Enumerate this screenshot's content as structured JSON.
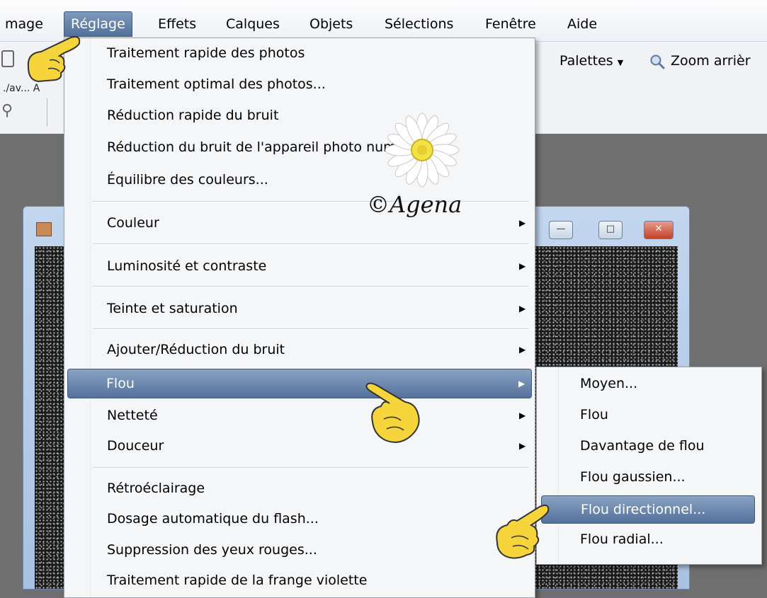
{
  "menubar": {
    "items": [
      "mage",
      "Réglage",
      "Effets",
      "Calques",
      "Objets",
      "Sélections",
      "Fenêtre",
      "Aide"
    ]
  },
  "toolbar": {
    "path_fragment": "./av... A",
    "palettes_label": "Palettes",
    "zoom_label": "Zoom arrièr"
  },
  "menu": {
    "group1": [
      "Traitement rapide des photos",
      "Traitement optimal des photos...",
      "Réduction rapide du bruit",
      "Réduction du bruit de l'appareil photo numérique...",
      "Équilibre des couleurs..."
    ],
    "couleur": "Couleur",
    "luminosite": "Luminosité et contraste",
    "teinte": "Teinte et saturation",
    "group5": [
      "Ajouter/Réduction du bruit",
      "Flou",
      "Netteté",
      "Douceur"
    ],
    "group6": [
      "Rétroéclairage",
      "Dosage automatique du flash...",
      "Suppression des yeux rouges...",
      "Traitement rapide de la frange violette"
    ]
  },
  "submenu": {
    "items": [
      "Moyen...",
      "Flou",
      "Davantage de flou",
      "Flou gaussien...",
      "Flou directionnel...",
      "Flou radial..."
    ]
  },
  "watermark": {
    "text": "©Agena"
  },
  "colors": {
    "highlight": "#6983aa",
    "menu_bg": "#f5f6f8",
    "close_button": "#d0533d"
  },
  "icons": [
    "pointing-hand-icon",
    "zoom-magnifier-icon",
    "submenu-arrow-icon",
    "daisy-flower-icon"
  ]
}
